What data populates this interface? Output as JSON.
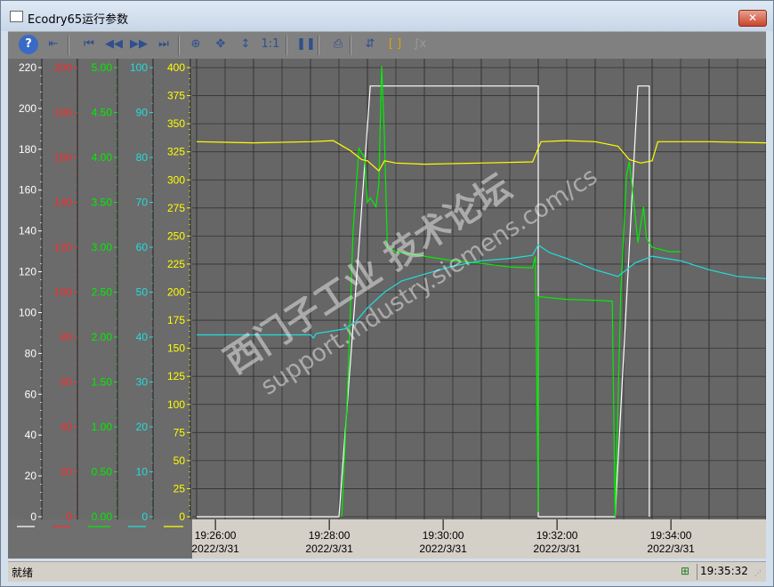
{
  "window": {
    "title": "Ecodry65运行参数",
    "close_label": "✕"
  },
  "toolbar": {
    "buttons": [
      {
        "name": "help-icon",
        "glyph": "?"
      },
      {
        "name": "import-icon",
        "glyph": "⇤"
      },
      {
        "name": "first-icon",
        "glyph": "⏮"
      },
      {
        "name": "prev-icon",
        "glyph": "◀◀"
      },
      {
        "name": "next-icon",
        "glyph": "▶▶"
      },
      {
        "name": "last-icon",
        "glyph": "⏭"
      },
      {
        "name": "zoom-area-icon",
        "glyph": "⊕"
      },
      {
        "name": "move-icon",
        "glyph": "✥"
      },
      {
        "name": "zoom-axis-icon",
        "glyph": "↕"
      },
      {
        "name": "original-size-icon",
        "glyph": "1:1"
      },
      {
        "name": "pause-icon",
        "glyph": "❚❚"
      },
      {
        "name": "print-icon",
        "glyph": "⎙"
      },
      {
        "name": "ruler-icon",
        "glyph": "⇵"
      },
      {
        "name": "select-statistics-icon",
        "glyph": "[ ]"
      },
      {
        "name": "statistics-icon",
        "glyph": "∫x"
      }
    ]
  },
  "status": {
    "text": "就绪",
    "time": "19:35:32"
  },
  "colors": {
    "plot_bg": "#666666",
    "grid": "#333333",
    "white": "#ffffff",
    "red": "#ff2a2a",
    "green": "#00ee00",
    "cyan": "#22dddd",
    "yellow": "#ffff00"
  },
  "watermark": {
    "line1": "西门子工业  技术论坛",
    "line2": "support.industry.siemens.com/cs"
  },
  "chart_data": {
    "type": "line",
    "x_ticks": [
      {
        "time": "19:26:00",
        "date": "2022/3/31"
      },
      {
        "time": "19:28:00",
        "date": "2022/3/31"
      },
      {
        "time": "19:30:00",
        "date": "2022/3/31"
      },
      {
        "time": "19:32:00",
        "date": "2022/3/31"
      },
      {
        "time": "19:34:00",
        "date": "2022/3/31"
      }
    ],
    "x_range_minutes": [
      "19:25:40",
      "19:35:40"
    ],
    "grid": true,
    "axes": [
      {
        "key": "white",
        "color": "#ffffff",
        "ticks": [
          "220",
          "200",
          "180",
          "160",
          "140",
          "120",
          "100",
          "80",
          "60",
          "40",
          "20",
          "0"
        ],
        "range": [
          0,
          220
        ]
      },
      {
        "key": "red",
        "color": "#ff2a2a",
        "ticks": [
          "200",
          "180",
          "160",
          "140",
          "120",
          "100",
          "80",
          "60",
          "40",
          "20",
          "0"
        ],
        "range": [
          0,
          200
        ]
      },
      {
        "key": "green",
        "color": "#00ee00",
        "ticks": [
          "5.00",
          "4.50",
          "4.00",
          "3.50",
          "3.00",
          "2.50",
          "2.00",
          "1.50",
          "1.00",
          "0.50",
          "0.00"
        ],
        "range": [
          0,
          5
        ]
      },
      {
        "key": "cyan",
        "color": "#22dddd",
        "ticks": [
          "100",
          "90",
          "80",
          "70",
          "60",
          "50",
          "40",
          "30",
          "20",
          "10",
          "0"
        ],
        "range": [
          0,
          100
        ]
      },
      {
        "key": "yellow",
        "color": "#ffff00",
        "ticks": [
          "400",
          "375",
          "350",
          "325",
          "300",
          "275",
          "250",
          "225",
          "200",
          "175",
          "150",
          "125",
          "100",
          "75",
          "50",
          "25",
          "0"
        ],
        "range": [
          0,
          400
        ]
      }
    ],
    "series": [
      {
        "key": "white",
        "axis": 0,
        "color": "#ffffff",
        "points": [
          [
            0,
            0
          ],
          [
            2.5,
            0
          ],
          [
            2.85,
            132
          ],
          [
            3.05,
            211
          ],
          [
            3.2,
            211
          ],
          [
            3.15,
            211
          ],
          [
            3.25,
            211
          ],
          [
            6,
            211
          ],
          [
            6,
            0
          ],
          [
            7.35,
            0
          ],
          [
            7.75,
            211
          ],
          [
            7.95,
            211
          ],
          [
            7.95,
            0
          ]
        ]
      },
      {
        "key": "green",
        "axis": 2,
        "color": "#00ee00",
        "points": [
          [
            2.55,
            0
          ],
          [
            2.65,
            1.4
          ],
          [
            2.75,
            3.2
          ],
          [
            2.85,
            4.1
          ],
          [
            2.95,
            4.0
          ],
          [
            3.0,
            3.5
          ],
          [
            3.05,
            3.55
          ],
          [
            3.15,
            3.45
          ],
          [
            3.2,
            3.7
          ],
          [
            3.25,
            5.1
          ],
          [
            3.3,
            4.2
          ],
          [
            3.35,
            3.0
          ],
          [
            3.5,
            2.95
          ],
          [
            4.0,
            2.9
          ],
          [
            4.5,
            2.85
          ],
          [
            5.0,
            2.82
          ],
          [
            5.5,
            2.78
          ],
          [
            5.9,
            2.77
          ],
          [
            5.95,
            2.9
          ],
          [
            6.0,
            0.05
          ],
          [
            6.0,
            2.45
          ],
          [
            6.5,
            2.42
          ],
          [
            7.0,
            2.41
          ],
          [
            7.3,
            2.4
          ],
          [
            7.35,
            0
          ],
          [
            7.45,
            2.5
          ],
          [
            7.55,
            3.8
          ],
          [
            7.6,
            3.95
          ],
          [
            7.68,
            3.5
          ],
          [
            7.75,
            3.05
          ],
          [
            7.8,
            3.25
          ],
          [
            7.85,
            3.45
          ],
          [
            7.9,
            3.1
          ],
          [
            8.0,
            3.0
          ],
          [
            8.3,
            2.95
          ],
          [
            8.5,
            2.95
          ]
        ]
      },
      {
        "key": "cyan",
        "axis": 3,
        "color": "#22dddd",
        "points": [
          [
            0,
            40.5
          ],
          [
            2.0,
            40.5
          ],
          [
            2.05,
            39.8
          ],
          [
            2.1,
            40.8
          ],
          [
            2.6,
            41.8
          ],
          [
            2.8,
            43.5
          ],
          [
            3.0,
            46.5
          ],
          [
            3.3,
            50.0
          ],
          [
            3.6,
            52.5
          ],
          [
            4.0,
            54.0
          ],
          [
            4.5,
            55.8
          ],
          [
            5.0,
            57.0
          ],
          [
            5.5,
            57.5
          ],
          [
            5.9,
            58.2
          ],
          [
            6.0,
            60.5
          ],
          [
            6.2,
            58.8
          ],
          [
            6.5,
            57.5
          ],
          [
            7.0,
            55.0
          ],
          [
            7.4,
            53.5
          ],
          [
            7.7,
            56.5
          ],
          [
            8.0,
            58.0
          ],
          [
            8.5,
            57.0
          ],
          [
            9.0,
            55.0
          ],
          [
            9.5,
            53.5
          ],
          [
            10.0,
            53.0
          ]
        ]
      },
      {
        "key": "yellow",
        "axis": 4,
        "color": "#ffff00",
        "points": [
          [
            0,
            334
          ],
          [
            1.0,
            333
          ],
          [
            2.0,
            334
          ],
          [
            2.4,
            335
          ],
          [
            2.7,
            326
          ],
          [
            2.9,
            318
          ],
          [
            3.0,
            317
          ],
          [
            3.2,
            308
          ],
          [
            3.3,
            317
          ],
          [
            3.5,
            315
          ],
          [
            4.0,
            314
          ],
          [
            5.0,
            315
          ],
          [
            5.9,
            316
          ],
          [
            6.05,
            334
          ],
          [
            6.5,
            335
          ],
          [
            7.0,
            334
          ],
          [
            7.4,
            330
          ],
          [
            7.6,
            318
          ],
          [
            7.8,
            315
          ],
          [
            8.0,
            317
          ],
          [
            8.1,
            334
          ],
          [
            9.0,
            334
          ],
          [
            10.0,
            333
          ]
        ]
      }
    ]
  }
}
